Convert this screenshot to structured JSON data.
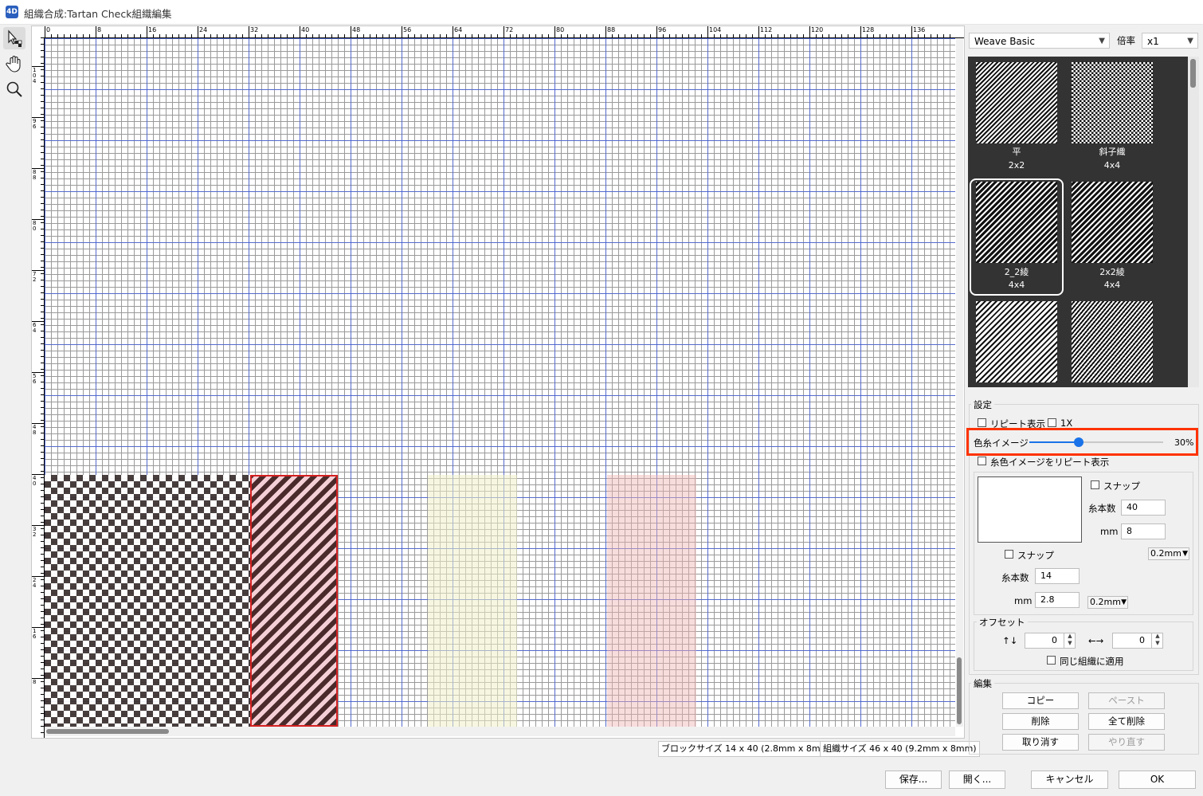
{
  "window": {
    "title": "組織合成:Tartan Check組織編集",
    "icon_text": "4D"
  },
  "ruler": {
    "top": [
      "0",
      "8",
      "16",
      "24",
      "32",
      "40",
      "48",
      "56",
      "64",
      "72",
      "80",
      "88",
      "96",
      "104",
      "112",
      "120",
      "128",
      "136"
    ],
    "left": [
      "104",
      "96",
      "88",
      "80",
      "72",
      "64",
      "56",
      "48",
      "40",
      "32",
      "24",
      "16",
      "8"
    ]
  },
  "right": {
    "library": "Weave Basic",
    "magnify_label": "倍率",
    "magnify_value": "x1",
    "swatches": [
      {
        "name": "平",
        "size": "2x2"
      },
      {
        "name": "斜子織",
        "size": "4x4"
      },
      {
        "name": "2_2綾",
        "size": "4x4"
      },
      {
        "name": "2x2綾",
        "size": "4x4"
      },
      {
        "name": "",
        "size": ""
      },
      {
        "name": "",
        "size": ""
      }
    ],
    "settings_label": "設定",
    "repeat_label": "リピート表示",
    "onex_label": "1X",
    "color_image_label": "色糸イメージ",
    "color_image_value": "30%",
    "color_image_fraction": 0.3,
    "repeat_color_label": "糸色イメージをリピート表示",
    "snap1_label": "スナップ",
    "count1_label": "糸本数",
    "count1_value": "40",
    "mm1_label": "mm",
    "mm1_value": "8",
    "unit1": "0.2mm",
    "snap2_label": "スナップ",
    "count2_label": "糸本数",
    "count2_value": "14",
    "mm2_label": "mm",
    "mm2_value": "2.8",
    "unit2": "0.2mm",
    "offset_label": "オフセット",
    "offset_v_icon": "↑↓",
    "offset_v_value": "0",
    "offset_h_icon": "←→",
    "offset_h_value": "0",
    "same_weave_label": "同じ組織に適用",
    "edit_label": "編集",
    "copy": "コピー",
    "paste": "ペースト",
    "delete": "削除",
    "delete_all": "全て削除",
    "undo": "取り消す",
    "redo": "やり直す"
  },
  "status": {
    "block_size": "ブロックサイズ 14 x 40 (2.8mm x 8mm)",
    "weave_size": "組織サイズ 46 x 40 (9.2mm x 8mm)"
  },
  "footer": {
    "save": "保存...",
    "open": "開く...",
    "cancel": "キャンセル",
    "ok": "OK"
  }
}
